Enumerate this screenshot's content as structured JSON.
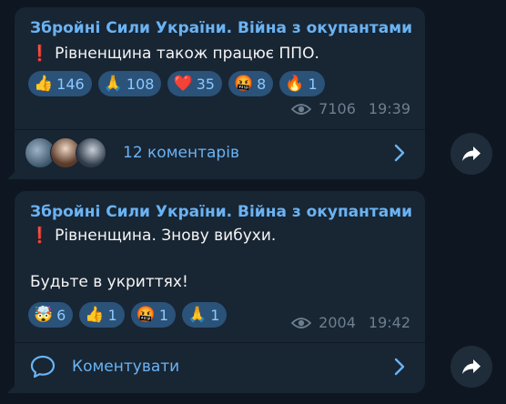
{
  "posts": [
    {
      "channel": "Збройні Сили України. Війна з окупантами",
      "text_lines": [
        "Рівненщина також працює ППО."
      ],
      "reactions": [
        {
          "emoji": "👍",
          "icon": "thumbs-up-icon",
          "count": "146"
        },
        {
          "emoji": "🙏",
          "icon": "praying-hands-icon",
          "count": "108"
        },
        {
          "emoji": "❤️",
          "icon": "heart-icon",
          "count": "35"
        },
        {
          "emoji": "🤬",
          "icon": "cursing-face-icon",
          "count": "8"
        },
        {
          "emoji": "🔥",
          "icon": "fire-icon",
          "count": "1"
        }
      ],
      "views": "7106",
      "time": "19:39",
      "comments_label": "12 коментарів"
    },
    {
      "channel": "Збройні Сили України. Війна з окупантами",
      "text_lines": [
        "Рівненщина. Знову вибухи.",
        "Будьте в укриттях!"
      ],
      "reactions": [
        {
          "emoji": "🤯",
          "icon": "exploding-head-icon",
          "count": "6"
        },
        {
          "emoji": "👍",
          "icon": "thumbs-up-icon",
          "count": "1"
        },
        {
          "emoji": "🤬",
          "icon": "cursing-face-icon",
          "count": "1"
        },
        {
          "emoji": "🙏",
          "icon": "praying-hands-icon",
          "count": "1"
        }
      ],
      "views": "2004",
      "time": "19:42",
      "comments_label": "Коментувати"
    }
  ],
  "colors": {
    "background": "#0e1621",
    "bubble": "#182533",
    "accent": "#6ab3f3",
    "reaction_bg": "#2b5278",
    "alert": "#e53935"
  }
}
